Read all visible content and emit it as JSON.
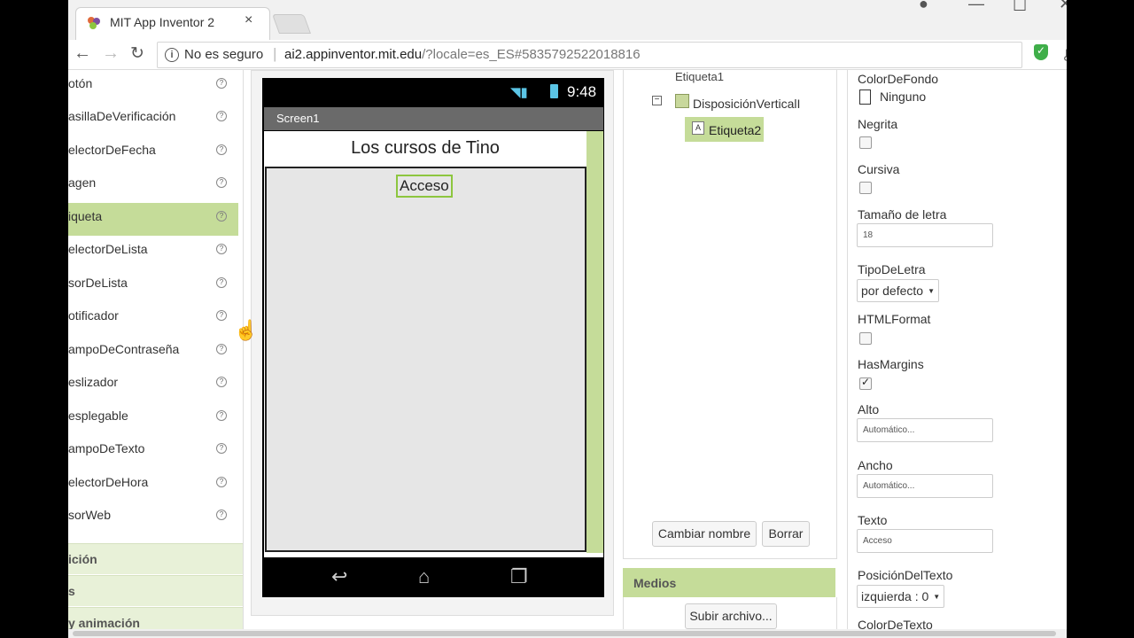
{
  "browser": {
    "tab_title": "MIT App Inventor 2",
    "tab_close": "×",
    "security_text": "No es seguro",
    "url_host": "ai2.appinventor.mit.edu",
    "url_path": "/?locale=es_ES#5835792522018816",
    "icons": [
      "back-icon",
      "forward-icon",
      "reload-icon",
      "info-icon",
      "key-icon",
      "star-icon",
      "shield-icon"
    ]
  },
  "palette": {
    "items": [
      {
        "label": "otón"
      },
      {
        "label": "asillaDeVerificación"
      },
      {
        "label": "electorDeFecha"
      },
      {
        "label": "agen"
      },
      {
        "label": "iqueta",
        "selected": true
      },
      {
        "label": "electorDeLista"
      },
      {
        "label": "sorDeLista"
      },
      {
        "label": "otificador"
      },
      {
        "label": "ampoDeContraseña"
      },
      {
        "label": "eslizador"
      },
      {
        "label": "esplegable"
      },
      {
        "label": "ampoDeTexto"
      },
      {
        "label": "electorDeHora"
      },
      {
        "label": "sorWeb"
      }
    ],
    "help_glyph": "?",
    "categories": [
      "ición",
      "s",
      "y animación"
    ]
  },
  "viewer": {
    "status_time": "9:48",
    "screen_title": "Screen1",
    "label1_text": "Los cursos de Tino",
    "label2_text": "Acceso"
  },
  "components": {
    "tree": {
      "etiqueta1": "Etiqueta1",
      "vertical_arrangement": "DisposiciónVerticalI",
      "etiqueta2": "Etiqueta2"
    },
    "rename_button": "Cambiar nombre",
    "delete_button": "Borrar"
  },
  "media": {
    "header": "Medios",
    "upload_button": "Subir archivo..."
  },
  "properties": {
    "color_fondo_label": "ColorDeFondo",
    "color_fondo_value": "Ninguno",
    "negrita_label": "Negrita",
    "cursiva_label": "Cursiva",
    "tamano_label": "Tamaño de letra",
    "tamano_value": "18",
    "tipo_label": "TipoDeLetra",
    "tipo_value": "por defecto",
    "html_label": "HTMLFormat",
    "margins_label": "HasMargins",
    "alto_label": "Alto",
    "alto_value": "Automático...",
    "ancho_label": "Ancho",
    "ancho_value": "Automático...",
    "texto_label": "Texto",
    "texto_value": "Acceso",
    "posicion_label": "PosiciónDelTexto",
    "posicion_value": "izquierda : 0",
    "color_texto_label": "ColorDeTexto",
    "negrita_checked": false,
    "cursiva_checked": false,
    "html_checked": false,
    "margins_checked": true
  },
  "colors": {
    "accent_green": "#c5dc99",
    "selection_border": "#8dc63f",
    "phone_status": "#5bc5e6"
  }
}
